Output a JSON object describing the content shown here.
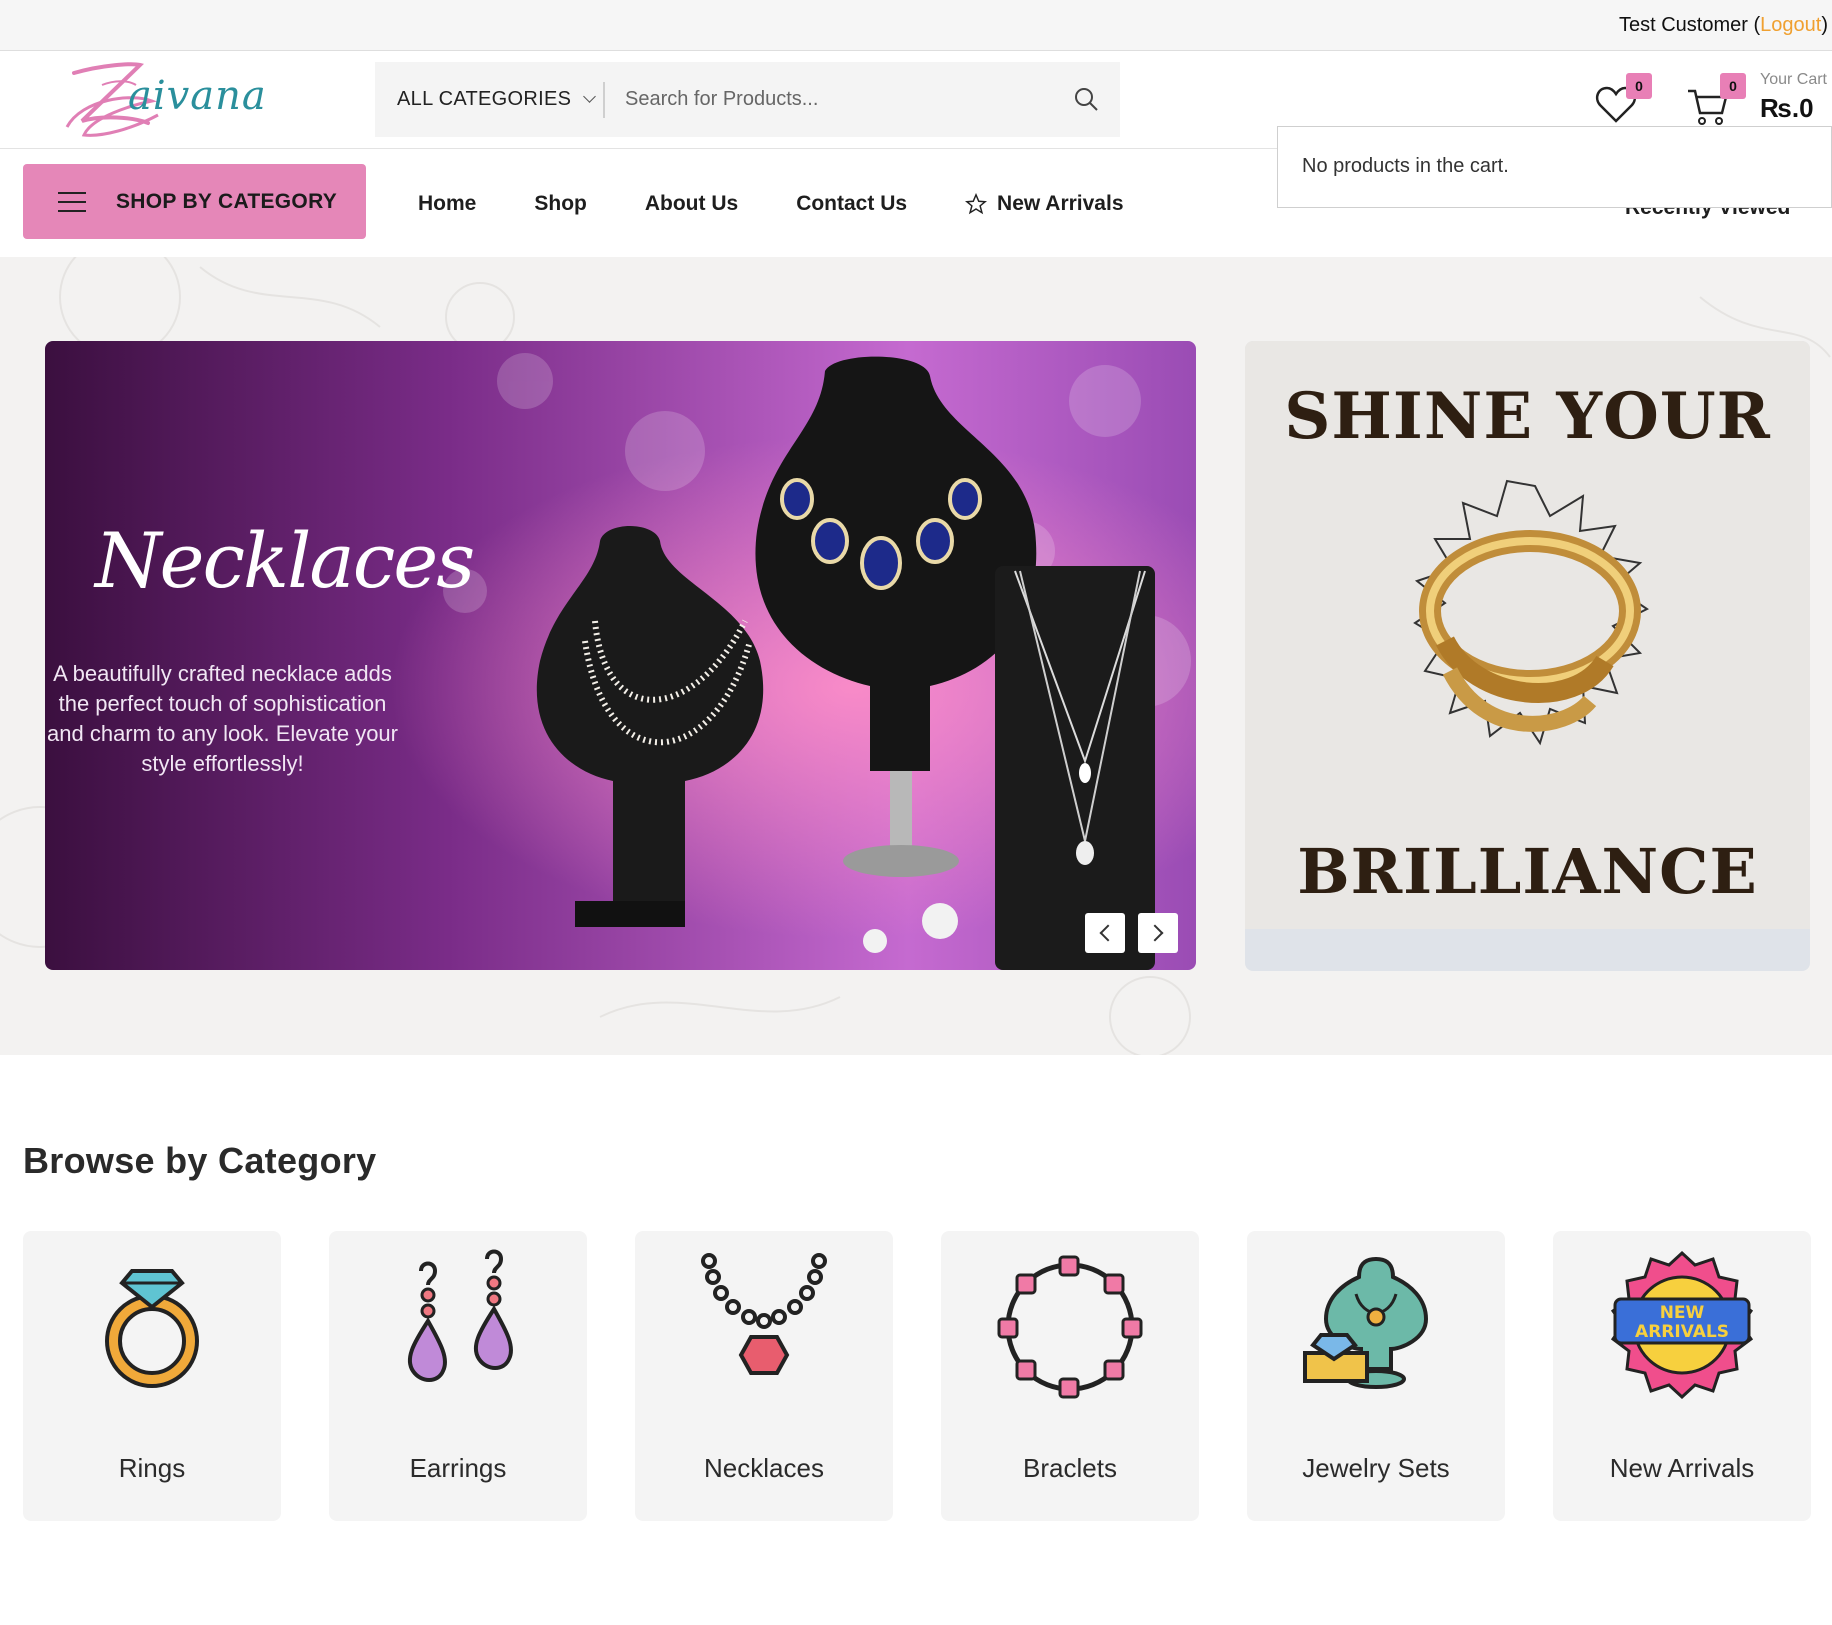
{
  "topbar": {
    "user_name": "Test Customer",
    "paren_open": "(",
    "logout": "Logout",
    "paren_close": ")"
  },
  "header": {
    "logo_text": "aivana",
    "category_select": "ALL CATEGORIES",
    "search_placeholder": "Search for Products...",
    "wishlist_count": "0",
    "cart_count": "0",
    "cart_label": "Your Cart",
    "cart_total": "₨.0",
    "cart_empty_message": "No products in the cart."
  },
  "nav": {
    "shop_by_category": "SHOP BY CATEGORY",
    "items": [
      "Home",
      "Shop",
      "About Us",
      "Contact Us",
      "New Arrivals"
    ],
    "recent": "Recently Viewed"
  },
  "hero": {
    "slide_title": "Necklaces",
    "slide_text": "A beautifully crafted necklace adds the perfect touch of sophistication and charm to any look. Elevate your style effortlessly!",
    "promo_line1": "SHINE YOUR",
    "promo_line2": "BRILLIANCE"
  },
  "browse": {
    "title": "Browse by Category",
    "categories": [
      "Rings",
      "Earrings",
      "Necklaces",
      "Braclets",
      "Jewelry Sets",
      "New Arrivals"
    ]
  },
  "colors": {
    "brand_pink": "#e587b8",
    "logo_teal": "#2a8f9c",
    "logout_orange": "#f0a030",
    "badge_pink": "#e87fb6"
  }
}
